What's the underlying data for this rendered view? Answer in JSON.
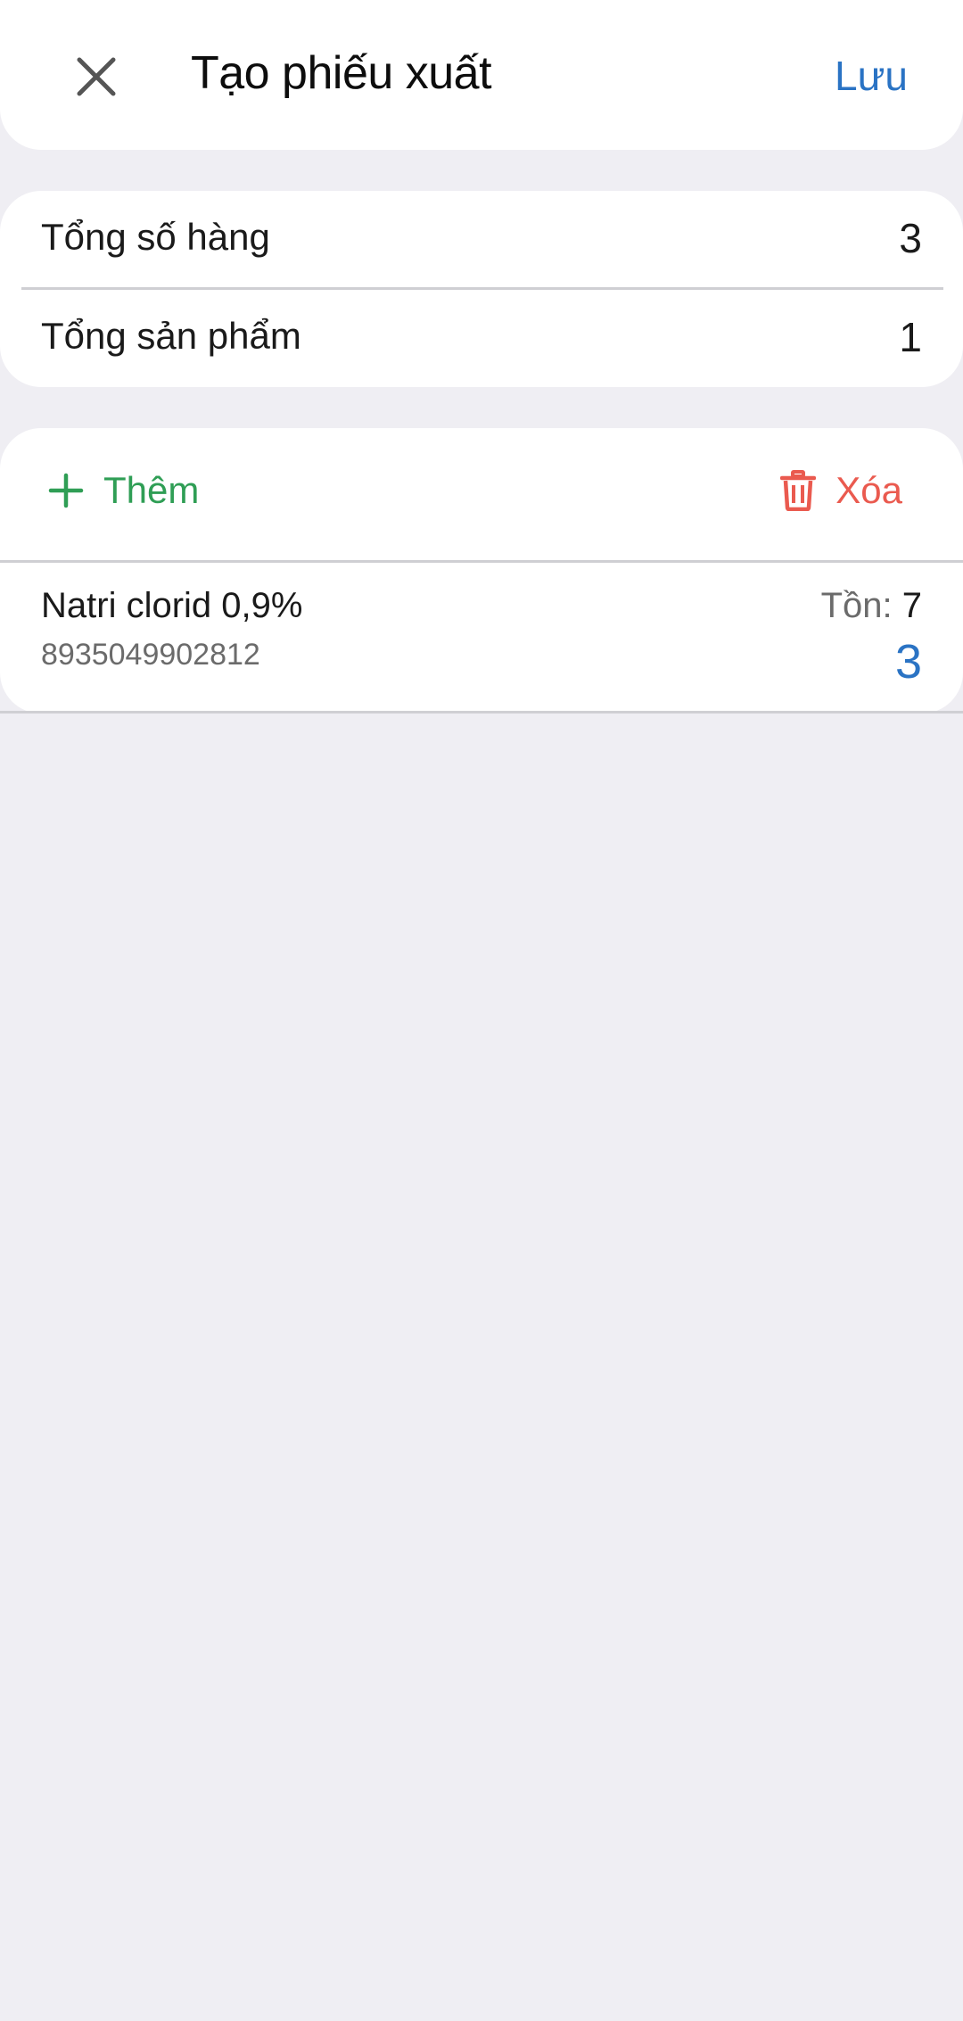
{
  "header": {
    "title": "Tạo phiếu xuất",
    "save_label": "Lưu",
    "close_icon": "close-icon"
  },
  "summary": {
    "total_items_label": "Tổng số hàng",
    "total_items_value": "3",
    "total_products_label": "Tổng sản phẩm",
    "total_products_value": "1"
  },
  "actions": {
    "add_label": "Thêm",
    "add_icon": "plus-icon",
    "delete_label": "Xóa",
    "delete_icon": "trash-icon"
  },
  "items": [
    {
      "name": "Natri clorid 0,9%",
      "code": "8935049902812",
      "stock_label": "Tồn:",
      "stock_value": "7",
      "quantity": "3"
    }
  ],
  "colors": {
    "accent_blue": "#2a73c4",
    "add_green": "#2f9e55",
    "delete_red": "#ea5a4f",
    "background": "#efeef3"
  }
}
